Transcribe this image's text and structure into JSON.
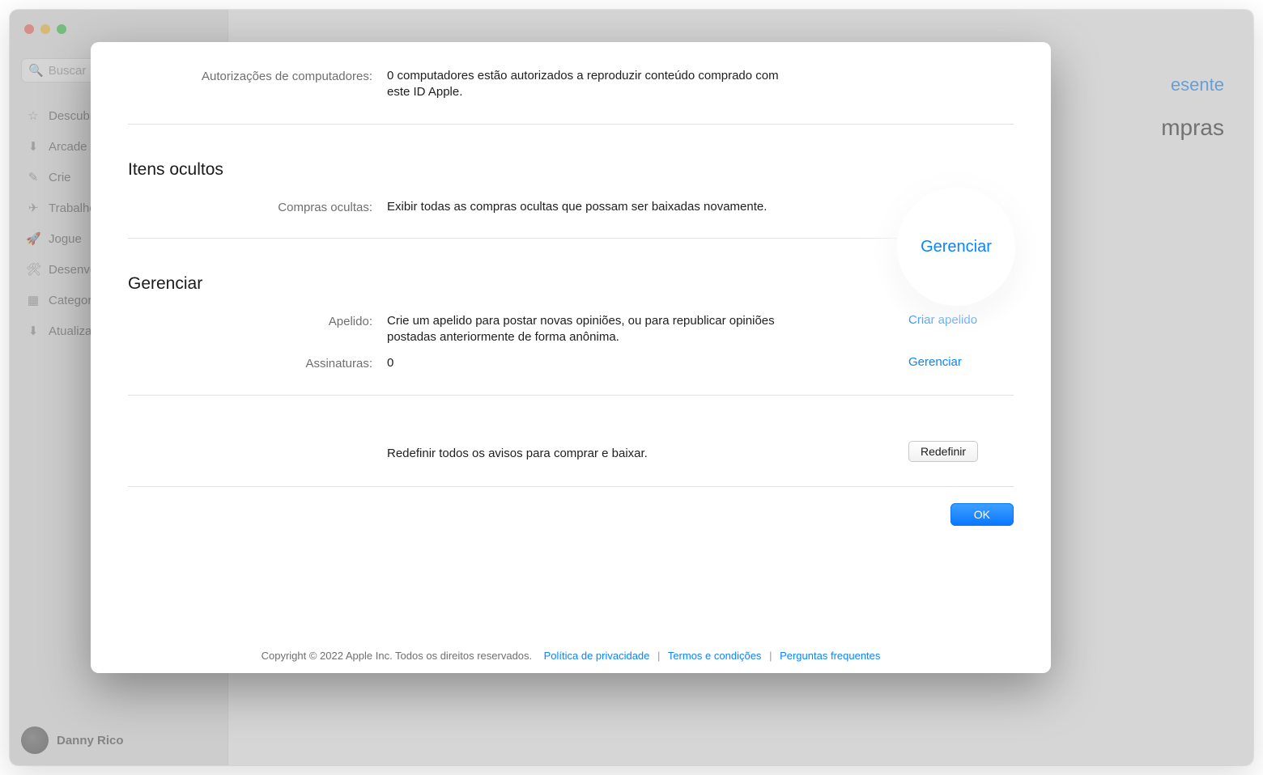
{
  "window": {
    "search_placeholder": "Buscar"
  },
  "sidebar": {
    "items": [
      {
        "label": "Descubra",
        "icon": "☆"
      },
      {
        "label": "Arcade",
        "icon": "⬇"
      },
      {
        "label": "Crie",
        "icon": "✎"
      },
      {
        "label": "Trabalhe",
        "icon": "✈"
      },
      {
        "label": "Jogue",
        "icon": "🚀"
      },
      {
        "label": "Desenvolva",
        "icon": "🛠"
      },
      {
        "label": "Categorias",
        "icon": "▦"
      },
      {
        "label": "Atualizações",
        "icon": "⬇"
      }
    ]
  },
  "user": {
    "name": "Danny Rico"
  },
  "background": {
    "link_text": "esente",
    "header_text": "mpras"
  },
  "authorizations": {
    "label": "Autorizações de computadores:",
    "value": "0 computadores estão autorizados a reproduzir conteúdo comprado com este ID Apple."
  },
  "hidden": {
    "section_title": "Itens ocultos",
    "label": "Compras ocultas:",
    "value": "Exibir todas as compras ocultas que possam ser baixadas novamente.",
    "action": "Gerenciar"
  },
  "manage": {
    "section_title": "Gerenciar",
    "nickname_label": "Apelido:",
    "nickname_value": "Crie um apelido para postar novas opiniões, ou para republicar opiniões postadas anteriormente de forma anônima.",
    "nickname_action": "Criar apelido",
    "subs_label": "Assinaturas:",
    "subs_value": "0",
    "subs_action": "Gerenciar"
  },
  "reset": {
    "value": "Redefinir todos os avisos para comprar e baixar.",
    "button": "Redefinir"
  },
  "ok_button": "OK",
  "footer": {
    "copyright": "Copyright © 2022 Apple Inc. Todos os direitos reservados.",
    "privacy": "Política de privacidade",
    "terms": "Termos e condições",
    "faq": "Perguntas frequentes"
  }
}
